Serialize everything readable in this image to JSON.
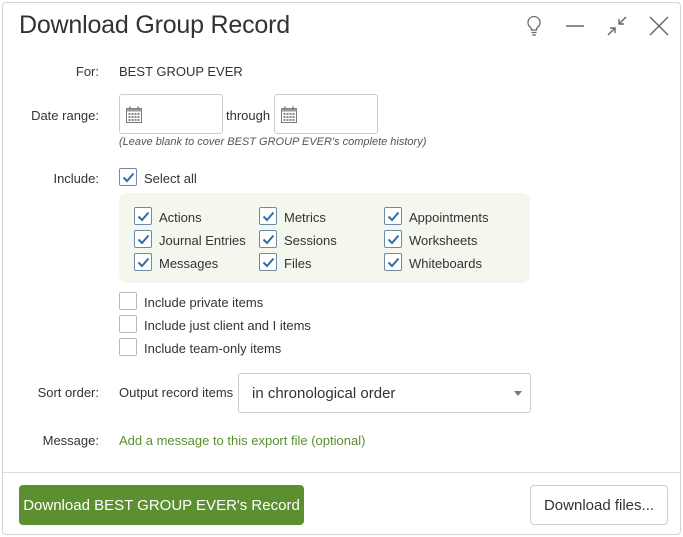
{
  "dialog": {
    "title": "Download Group Record"
  },
  "window_controls": [
    "lightbulb-icon",
    "minimize-icon",
    "collapse-icon",
    "close-icon"
  ],
  "form": {
    "for_label": "For:",
    "for_value": "BEST GROUP EVER",
    "date_range_label": "Date range:",
    "date_start_value": "",
    "date_end_value": "",
    "through_text": "through",
    "date_hint": "(Leave blank to cover BEST GROUP EVER's complete history)",
    "include_label": "Include:",
    "select_all_label": "Select all",
    "select_all_checked": true,
    "include_items": [
      {
        "label": "Actions",
        "checked": true
      },
      {
        "label": "Metrics",
        "checked": true
      },
      {
        "label": "Appointments",
        "checked": true
      },
      {
        "label": "Journal Entries",
        "checked": true
      },
      {
        "label": "Sessions",
        "checked": true
      },
      {
        "label": "Worksheets",
        "checked": true
      },
      {
        "label": "Messages",
        "checked": true
      },
      {
        "label": "Files",
        "checked": true
      },
      {
        "label": "Whiteboards",
        "checked": true
      }
    ],
    "privacy_options": [
      {
        "label": "Include private items",
        "checked": false
      },
      {
        "label": "Include just client and I items",
        "checked": false
      },
      {
        "label": "Include team-only items",
        "checked": false
      }
    ],
    "sort_order_label": "Sort order:",
    "sort_prefix": "Output record items",
    "sort_selected": "in chronological order",
    "message_label": "Message:",
    "message_link": "Add a message to this export file (optional)"
  },
  "footer": {
    "primary_button": "Download BEST GROUP EVER's Record",
    "secondary_button": "Download files..."
  },
  "colors": {
    "accent_green": "#5b8f30",
    "link_green": "#5a8f2e",
    "panel_bg": "#f3f7ee",
    "check_blue": "#2f6ea8"
  }
}
